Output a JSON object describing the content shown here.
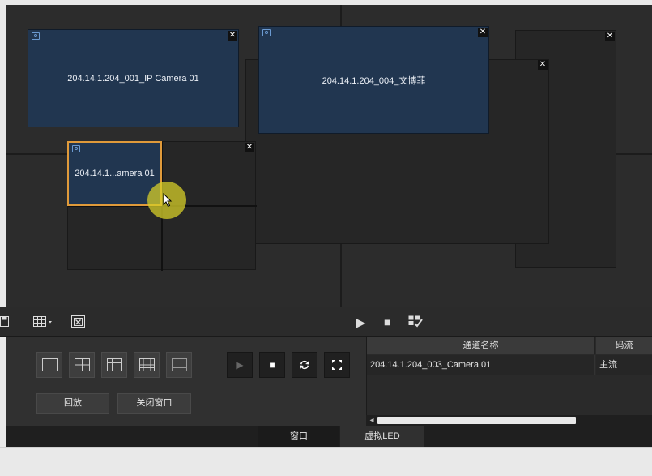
{
  "stage": {
    "windows": [
      {
        "label": "204.14.1.204_001_IP Camera 01",
        "close": "✕"
      },
      {
        "label": "204.14.1.204_004_文博菲",
        "close": "✕"
      },
      {
        "label": "204.14.1...amera 01",
        "close": "✕"
      }
    ],
    "extra_close": "✕"
  },
  "toolbar": {
    "save_icon": "save-icon",
    "grid_icon": "grid-dropdown-icon",
    "clear_icon": "clear-windows-icon",
    "play_icon": "▶",
    "stop_icon": "■",
    "check_icon": "check-window-icon"
  },
  "controls": {
    "layouts": [
      "1x1",
      "2x2",
      "3x3",
      "4x4",
      "custom"
    ],
    "play": "▶",
    "stop": "■",
    "refresh": "refresh-icon",
    "fullscreen": "fullscreen-icon",
    "playback_label": "回放",
    "close_window_label": "关闭窗口"
  },
  "channel_table": {
    "headers": [
      "通道名称",
      "码流"
    ],
    "rows": [
      {
        "name": "204.14.1.204_003_Camera 01",
        "stream": "主流"
      }
    ],
    "scroll_left": "◂"
  },
  "tabs": [
    "窗口",
    "虚拟LED"
  ],
  "colors": {
    "video_window": "#213650",
    "selection": "#e09a3a",
    "cursor_highlight": "#d6cd28"
  }
}
